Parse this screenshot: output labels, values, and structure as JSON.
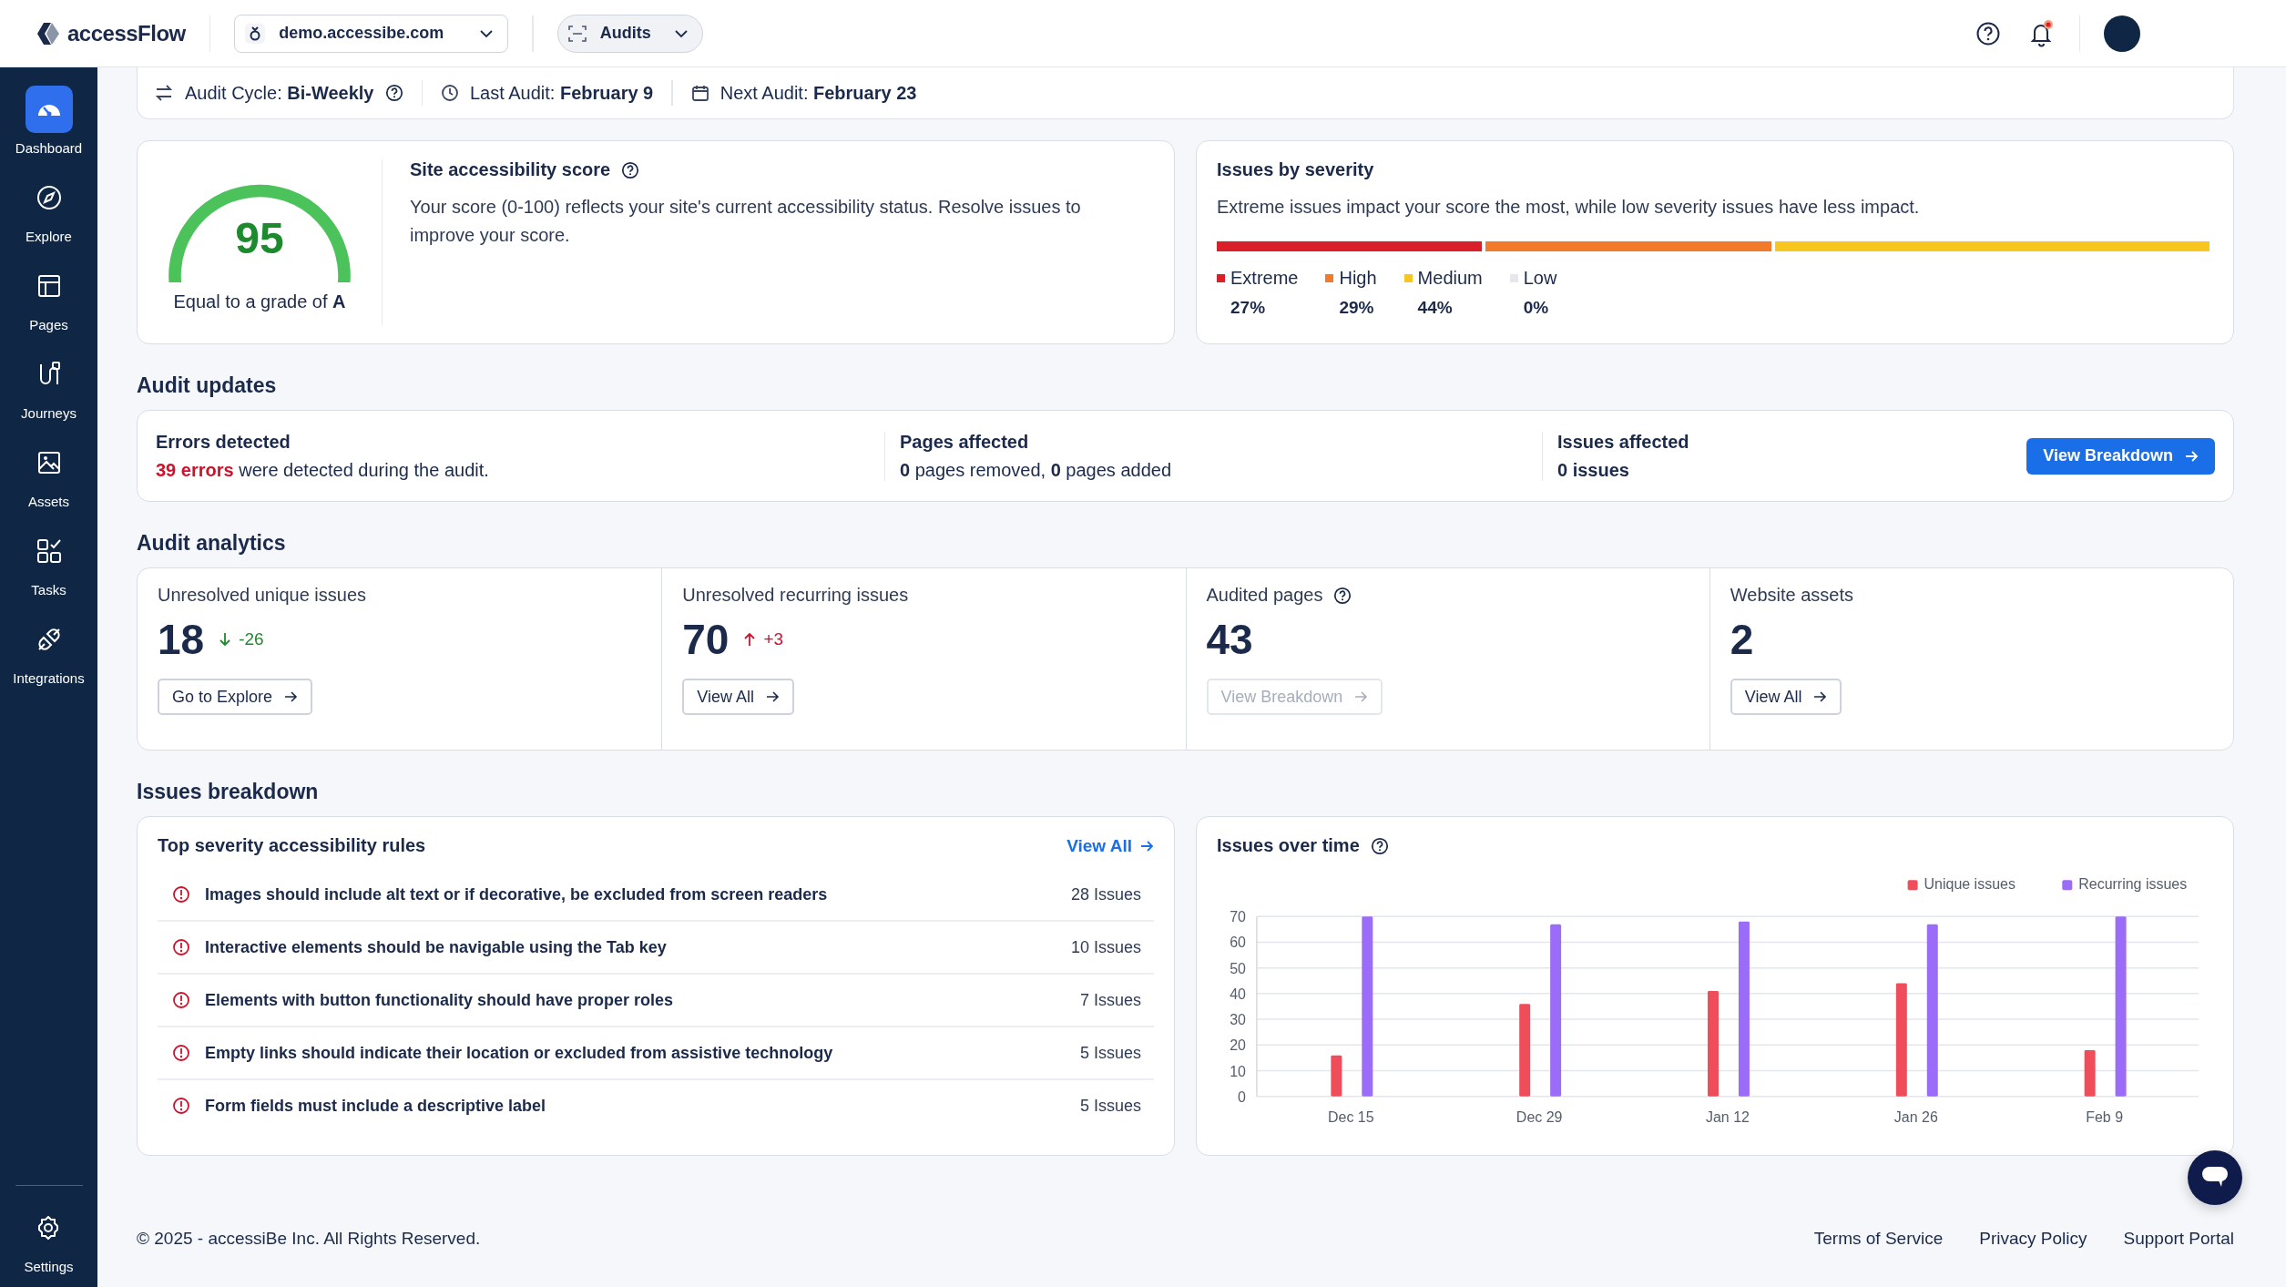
{
  "topbar": {
    "brand": "accessFlow",
    "site_select": "demo.accessibe.com",
    "view_select": "Audits"
  },
  "sidebar": {
    "items": [
      {
        "label": "Dashboard",
        "kind": "dashboard",
        "selected": true
      },
      {
        "label": "Explore",
        "kind": "explore",
        "selected": false
      },
      {
        "label": "Pages",
        "kind": "pages",
        "selected": false
      },
      {
        "label": "Journeys",
        "kind": "journeys",
        "selected": false
      },
      {
        "label": "Assets",
        "kind": "assets",
        "selected": false
      },
      {
        "label": "Tasks",
        "kind": "tasks",
        "selected": false
      },
      {
        "label": "Integrations",
        "kind": "integrations",
        "selected": false
      }
    ],
    "settings": "Settings"
  },
  "audit_bar": {
    "cycle": "Audit Cycle: **Bi-Weekly**",
    "last": "Last Audit: **February 9**",
    "next": "Next Audit: **February 23**"
  },
  "score_card": {
    "score": "95",
    "level": 0.95,
    "grade": "Equal to a grade of **A**",
    "title": "Site accessibility score",
    "description": "Your score (0-100) reflects your site's current accessibility status. Resolve issues to improve your score."
  },
  "severity_card": {
    "title": "Issues by severity",
    "description": "Extreme issues impact your score the most, while low severity issues have less impact.",
    "levels": [
      {
        "label": "Extreme",
        "percent": "27%",
        "color": "#d9202a"
      },
      {
        "label": "High",
        "percent": "29%",
        "color": "#f27b2b"
      },
      {
        "label": "Medium",
        "percent": "44%",
        "color": "#f7c71f"
      },
      {
        "label": "Low",
        "percent": "0%",
        "color": "#e5e7eb"
      }
    ]
  },
  "audit_updates": {
    "heading": "Audit updates",
    "items": [
      {
        "title": "Errors detected",
        "text": "**39 errors** were detected during the audit.",
        "kind": "error"
      },
      {
        "title": "Pages affected",
        "text": "**0** pages removed, **0** pages added",
        "kind": "plain"
      },
      {
        "title": "Issues affected",
        "text": "**0 issues**",
        "kind": "plain"
      }
    ],
    "button": "View Breakdown"
  },
  "audit_analytics": {
    "heading": "Audit analytics",
    "cells": [
      {
        "title": "Unresolved unique issues",
        "value": "18",
        "delta": "-26",
        "kind": "down",
        "help": false,
        "button": "Go to Explore",
        "disabled": false
      },
      {
        "title": "Unresolved recurring issues",
        "value": "70",
        "delta": "+3",
        "kind": "up",
        "help": false,
        "button": "View All",
        "disabled": false
      },
      {
        "title": "Audited pages",
        "value": "43",
        "help": true,
        "button": "View Breakdown",
        "disabled": true
      },
      {
        "title": "Website assets",
        "value": "2",
        "help": false,
        "button": "View All",
        "disabled": false
      }
    ]
  },
  "issues_breakdown": {
    "heading": "Issues breakdown",
    "rules": {
      "title": "Top severity accessibility rules",
      "link": "View All",
      "rows": [
        {
          "rule": "Images should include alt text or if decorative, be excluded from screen readers",
          "count": "28 Issues"
        },
        {
          "rule": "Interactive elements should be navigable using the Tab key",
          "count": "10 Issues"
        },
        {
          "rule": "Elements with button functionality should have proper roles",
          "count": "7 Issues"
        },
        {
          "rule": "Empty links should indicate their location or excluded from assistive technology",
          "count": "5 Issues"
        },
        {
          "rule": "Form fields must include a descriptive label",
          "count": "5 Issues"
        }
      ]
    },
    "over_time": {
      "title": "Issues over time",
      "chart_data": {
        "type": "bar",
        "categories": [
          "Dec 15",
          "Dec 29",
          "Jan 12",
          "Jan 26",
          "Feb 9"
        ],
        "series": [
          {
            "name": "Unique issues",
            "color": "#ef4d5a",
            "values": [
              16,
              36,
              41,
              44,
              18
            ]
          },
          {
            "name": "Recurring issues",
            "color": "#9b6cf7",
            "values": [
              70,
              67,
              68,
              67,
              70
            ]
          }
        ],
        "ylim": [
          0,
          70
        ],
        "grid": true,
        "legend": "top-right",
        "yticks": [
          0,
          10,
          20,
          30,
          40,
          50,
          60,
          70
        ]
      }
    }
  },
  "footer": {
    "copyright": "© 2025 - accessiBe Inc. All Rights Reserved.",
    "links": [
      "Terms of Service",
      "Privacy Policy",
      "Support Portal"
    ]
  }
}
